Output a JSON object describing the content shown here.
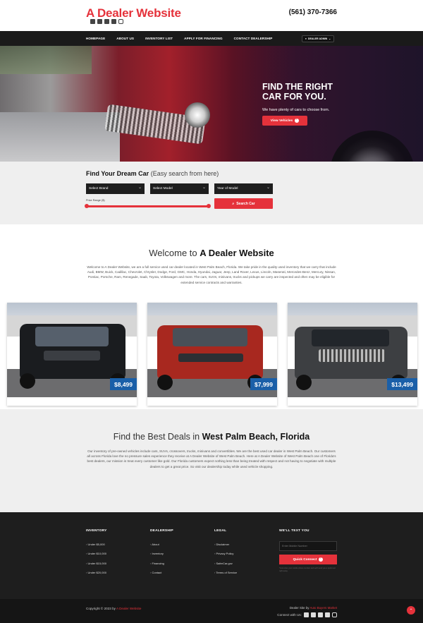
{
  "header": {
    "logo": "A Dealer Website",
    "phone": "(561) 370-7366",
    "social_icons": [
      "facebook-icon",
      "twitter-icon",
      "linkedin-icon",
      "googleplus-icon",
      "instagram-icon"
    ]
  },
  "nav": {
    "items": [
      "HOMEPAGE",
      "ABOUT US",
      "INVENTORY LIST",
      "APPLY FOR FINANCING",
      "CONTACT DEALERSHIP"
    ],
    "admin_label": "DEALER ADMIN"
  },
  "hero": {
    "title": "FIND THE RIGHT CAR FOR YOU.",
    "subtitle": "We have plenty of cars to choose from.",
    "button": "View Vehicles"
  },
  "search": {
    "title": "Find Your Dream Car",
    "title_suffix": "(Easy search from here)",
    "brand": "Select Brand",
    "model": "Select Model",
    "year": "Year of Model",
    "price_label": "Price Range ($)",
    "button": "Search Car"
  },
  "welcome": {
    "title_prefix": "Welcome to",
    "title_bold": "A Dealer Website",
    "text": "Welcome to A Dealer Website, we are a full service used car dealer located in West Palm Beach, Florida. We take pride in the quality used inventory that we carry that include Audi, BMW, Buick, Cadillac, Chevrolet, Chrysler, Dodge, Ford, GMC, Honda, Hyundai, Jaguar, Jeep, Land Rover, Lexus, Lincoln, Maserati, Mercedes-Benz, Mercury, Nissan, Pontiac, Porsche, Ram, Renegade, Saab, Toyota, Volkswagen and more. The cars, SUVs, minivans, trucks and pickups we carry are inspected and often may be eligible for extended service contracts and warranties.",
    "cards": [
      {
        "price": "$8,499",
        "color": "#1a1c1f"
      },
      {
        "price": "$7,999",
        "color": "#a8281f"
      },
      {
        "price": "$13,499",
        "color": "#3d3f42"
      }
    ]
  },
  "deals": {
    "title_prefix": "Find the Best Deals in",
    "title_bold": "West Palm Beach, Florida",
    "text": "Our inventory of pre-owned vehicles include cars, SUVs, crossovers, trucks, minivans and convertibles. We are the best used car dealer in West Palm Beach. Our customers all across Florida love the no pressure sales experience they receive at A Dealer Website of West Palm Beach. Here at A Dealer Website of West Palm Beach one of Florida's best dealers, our mission is treat every customer like gold. Our Florida customers expect nothing less than being treated with respect and not having to negotiate with multiple dealers to get a great price. So visit our dealership today while used vehicle shopping."
  },
  "footer": {
    "inventory": {
      "title": "INVENTORY",
      "items": [
        "Under $5,000",
        "Under $10,000",
        "Under $15,000",
        "Under $20,000"
      ]
    },
    "dealership": {
      "title": "DEALERSHIP",
      "items": [
        "About",
        "Inventory",
        "Financing",
        "Contact"
      ]
    },
    "legal": {
      "title": "LEGAL",
      "items": [
        "Disclaimer",
        "Privacy Policy",
        "SaferCar.gov",
        "Terms of Service"
      ]
    },
    "text_us": {
      "title": "WE'LL TEXT YOU",
      "placeholder": "Enter Mobile Number",
      "button": "Quick Connect",
      "note": "*Just enter your mobile phone number and we'll send you a quick text right away."
    },
    "copyright_prefix": "Copyright © 2023 by",
    "copyright_link": "A Dealer Website",
    "credit_prefix": "Dealer Site by",
    "credit_link": "Auto Buyers Market",
    "connect_label": "Connect with Us:"
  },
  "colors": {
    "accent": "#e5323b",
    "price_badge": "#1a5fa8",
    "dark": "#1e1e1e"
  }
}
